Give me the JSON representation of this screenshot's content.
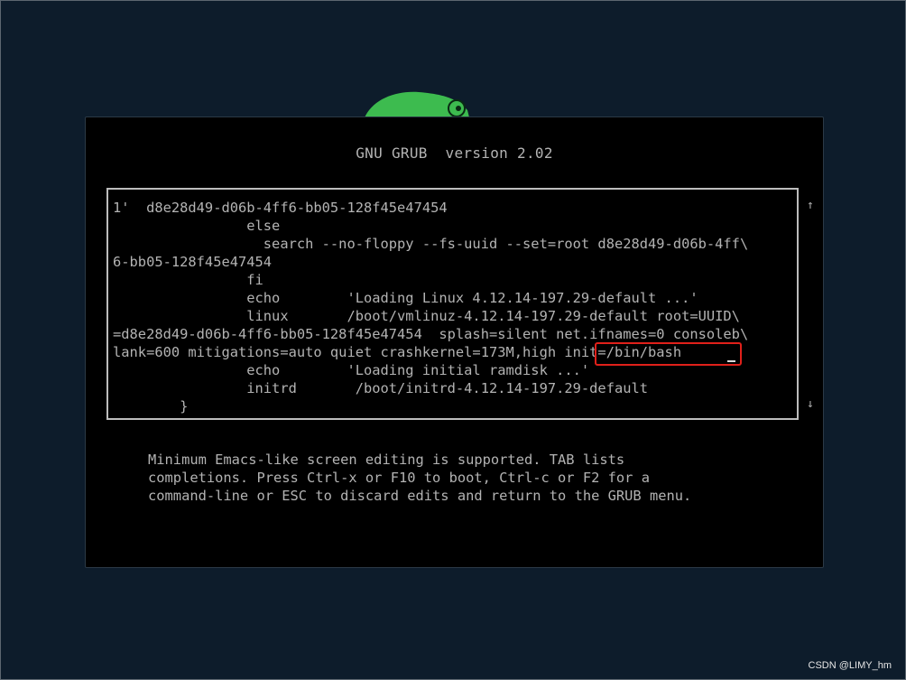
{
  "grub": {
    "title": "GNU GRUB  version 2.02",
    "editor_lines": [
      "1'  d8e28d49-d06b-4ff6-bb05-128f45e47454",
      "                else",
      "                  search --no-floppy --fs-uuid --set=root d8e28d49-d06b-4ff\\",
      "6-bb05-128f45e47454",
      "                fi",
      "                echo        'Loading Linux 4.12.14-197.29-default ...'",
      "                linux       /boot/vmlinuz-4.12.14-197.29-default root=UUID\\",
      "=d8e28d49-d06b-4ff6-bb05-128f45e47454  splash=silent net.ifnames=0 consoleb\\",
      "lank=600 mitigations=auto quiet crashkernel=173M,high init=/bin/bash",
      "                echo        'Loading initial ramdisk ...'",
      "                initrd       /boot/initrd-4.12.14-197.29-default",
      "        }"
    ],
    "help_lines": [
      "Minimum Emacs-like screen editing is supported. TAB lists",
      "completions. Press Ctrl-x or F10 to boot, Ctrl-c or F2 for a",
      "command-line or ESC to discard edits and return to the GRUB menu."
    ],
    "scroll_up": "↑",
    "scroll_down": "↓",
    "highlighted_text": "init=/bin/bash"
  },
  "watermark": "CSDN @LIMY_hm",
  "icons": {
    "logo": "opensuse-chameleon-icon"
  },
  "colors": {
    "desktop_bg": "#0d1c2b",
    "console_bg": "#000000",
    "console_text": "#b3b3b3",
    "highlight_border": "#e0201a",
    "logo_green": "#3dbb4f"
  }
}
